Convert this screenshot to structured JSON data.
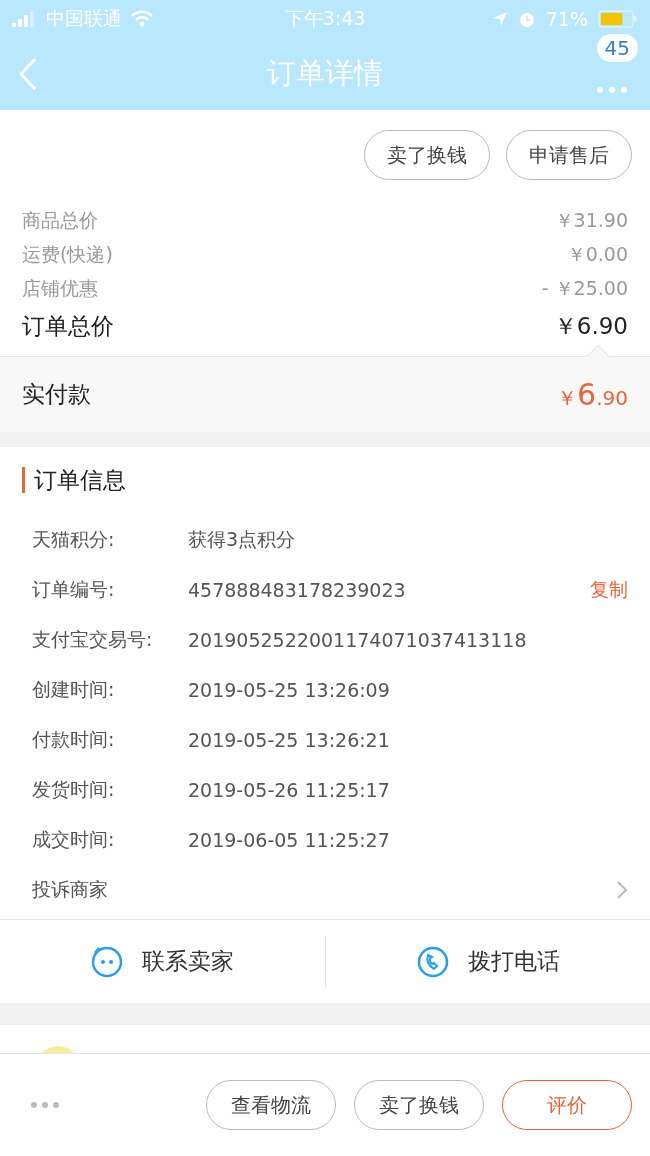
{
  "status_bar": {
    "carrier": "中国联通",
    "time": "下午3:43",
    "battery_text": "71%"
  },
  "nav": {
    "title": "订单详情",
    "badge": "45"
  },
  "top_actions": [
    "卖了换钱",
    "申请售后"
  ],
  "price_lines": [
    {
      "label": "商品总价",
      "value": "￥31.90"
    },
    {
      "label": "运费(快递)",
      "value": "￥0.00"
    },
    {
      "label": "店铺优惠",
      "value": "- ￥25.00"
    }
  ],
  "order_total": {
    "label": "订单总价",
    "value": "￥6.90"
  },
  "paid": {
    "label": "实付款",
    "currency": "￥",
    "integer": "6",
    "decimal": ".90"
  },
  "order_info": {
    "title": "订单信息",
    "rows": [
      {
        "label": "天猫积分:",
        "value": "获得3点积分"
      },
      {
        "label": "订单编号:",
        "value": "457888483178239023",
        "action": "复制"
      },
      {
        "label": "支付宝交易号:",
        "value": "2019052522001174071037413118"
      },
      {
        "label": "创建时间:",
        "value": "2019-05-25 13:26:09"
      },
      {
        "label": "付款时间:",
        "value": "2019-05-25 13:26:21"
      },
      {
        "label": "发货时间:",
        "value": "2019-05-26 11:25:17"
      },
      {
        "label": "成交时间:",
        "value": "2019-06-05 11:25:27"
      }
    ],
    "complaint": "投诉商家"
  },
  "contact": [
    {
      "kind": "chat",
      "label": "联系卖家"
    },
    {
      "kind": "phone",
      "label": "拨打电话"
    }
  ],
  "bottom_buttons": [
    {
      "label": "查看物流",
      "primary": false
    },
    {
      "label": "卖了换钱",
      "primary": false
    },
    {
      "label": "评价",
      "primary": true
    }
  ]
}
